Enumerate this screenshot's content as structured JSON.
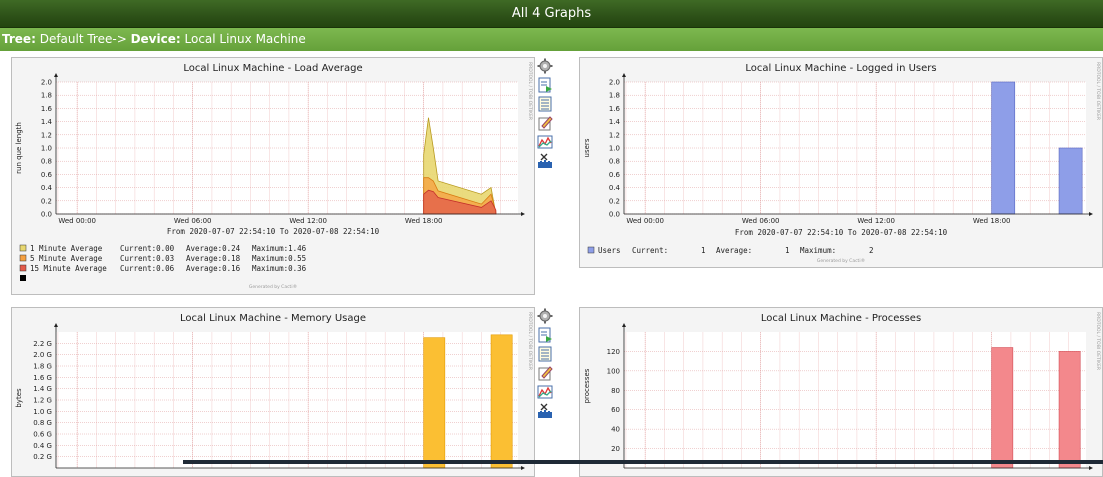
{
  "header": {
    "title": "All 4 Graphs"
  },
  "breadcrumb": {
    "tree_label": "Tree:",
    "tree_value": "Default Tree->",
    "device_label": "Device:",
    "device_value": "Local Linux Machine"
  },
  "actions": [
    "gear-icon",
    "zoom-graph-icon",
    "csv-export-icon",
    "edit-graph-icon",
    "realtime-icon",
    "settings-icon"
  ],
  "graphs": [
    {
      "title": "Local Linux Machine - Load Average",
      "side_text": "RRDTOOL / TOBI OETIKER",
      "ylabel": "run que length",
      "yticks": [
        "2.0",
        "1.8",
        "1.6",
        "1.4",
        "1.2",
        "1.0",
        "0.8",
        "0.6",
        "0.4",
        "0.2",
        "0.0"
      ],
      "xticks": [
        "Wed 00:00",
        "Wed 06:00",
        "Wed 12:00",
        "Wed 18:00"
      ],
      "range": "From 2020-07-07 22:54:10 To 2020-07-08 22:54:10",
      "legend": [
        {
          "name": "1 Minute Average ",
          "current": "Current:0.00",
          "average": "Average:0.24",
          "maximum": "Maximum:1.46",
          "color": "#e8d770"
        },
        {
          "name": "5 Minute Average ",
          "current": "Current:0.03",
          "average": "Average:0.18",
          "maximum": "Maximum:0.55",
          "color": "#f5a040"
        },
        {
          "name": "15 Minute Average",
          "current": "Current:0.06",
          "average": "Average:0.16",
          "maximum": "Maximum:0.36",
          "color": "#e35b4a"
        }
      ],
      "generated": "Generated by Cacti®"
    },
    {
      "title": "Local Linux Machine - Logged in Users",
      "side_text": "RRDTOOL / TOBI OETIKER",
      "ylabel": "users",
      "yticks": [
        "2.0",
        "1.8",
        "1.6",
        "1.4",
        "1.2",
        "1.0",
        "0.8",
        "0.6",
        "0.4",
        "0.2",
        "0.0"
      ],
      "xticks": [
        "Wed 00:00",
        "Wed 06:00",
        "Wed 12:00",
        "Wed 18:00"
      ],
      "range": "From 2020-07-07 22:54:10 To 2020-07-08 22:54:10",
      "legend": [
        {
          "name": "Users",
          "current": "Current:",
          "current_val": "1",
          "average": "Average:",
          "average_val": "1",
          "maximum": "Maximum:",
          "maximum_val": "2",
          "color": "#8e9ee8"
        }
      ],
      "generated": "Generated by Cacti®"
    },
    {
      "title": "Local Linux Machine - Memory Usage",
      "side_text": "RRDTOOL / TOBI OETIKER",
      "ylabel": "bytes",
      "yticks": [
        "2.2 G",
        "2.0 G",
        "1.8 G",
        "1.6 G",
        "1.4 G",
        "1.2 G",
        "1.0 G",
        "0.8 G",
        "0.6 G",
        "0.4 G",
        "0.2 G"
      ]
    },
    {
      "title": "Local Linux Machine - Processes",
      "side_text": "RRDTOOL / TOBI OETIKER",
      "ylabel": "processes",
      "yticks": [
        "120",
        "100",
        "80",
        "60",
        "40",
        "20"
      ]
    }
  ],
  "chart_data": [
    {
      "type": "area",
      "title": "Local Linux Machine - Load Average",
      "ylabel": "run que length",
      "ylim": [
        0,
        2.0
      ],
      "grid": true,
      "series": [
        {
          "name": "1 Minute Average",
          "x": [
            "Wed 18:00",
            "Wed 18:15",
            "Wed 18:30",
            "Wed 18:45",
            "Wed 21:00",
            "Wed 21:30",
            "Wed 21:45"
          ],
          "values": [
            0.9,
            1.46,
            1.0,
            0.5,
            0.3,
            0.4,
            0.0
          ]
        },
        {
          "name": "5 Minute Average",
          "x": [
            "Wed 18:00",
            "Wed 18:15",
            "Wed 18:30",
            "Wed 18:45",
            "Wed 21:00",
            "Wed 21:30",
            "Wed 21:45"
          ],
          "values": [
            0.55,
            0.55,
            0.5,
            0.35,
            0.15,
            0.3,
            0.03
          ]
        },
        {
          "name": "15 Minute Average",
          "x": [
            "Wed 18:00",
            "Wed 18:15",
            "Wed 18:30",
            "Wed 18:45",
            "Wed 21:00",
            "Wed 21:30",
            "Wed 21:45"
          ],
          "values": [
            0.3,
            0.36,
            0.34,
            0.25,
            0.1,
            0.2,
            0.06
          ]
        }
      ]
    },
    {
      "type": "bar",
      "title": "Local Linux Machine - Logged in Users",
      "ylabel": "users",
      "ylim": [
        0,
        2.0
      ],
      "grid": true,
      "series": [
        {
          "name": "Users",
          "x": [
            "Wed 18:00",
            "Wed 21:30"
          ],
          "values": [
            2,
            1
          ]
        }
      ]
    },
    {
      "type": "area",
      "title": "Local Linux Machine - Memory Usage",
      "ylabel": "bytes",
      "ylim": [
        0,
        2.4
      ],
      "grid": true,
      "series": [
        {
          "x": [
            "Wed 18:00",
            "Wed 21:30"
          ],
          "values": [
            2.3,
            2.35
          ]
        }
      ]
    },
    {
      "type": "area",
      "title": "Local Linux Machine - Processes",
      "ylabel": "processes",
      "ylim": [
        0,
        140
      ],
      "grid": true,
      "series": [
        {
          "x": [
            "Wed 18:00",
            "Wed 21:30"
          ],
          "values": [
            124,
            120
          ]
        }
      ]
    }
  ]
}
